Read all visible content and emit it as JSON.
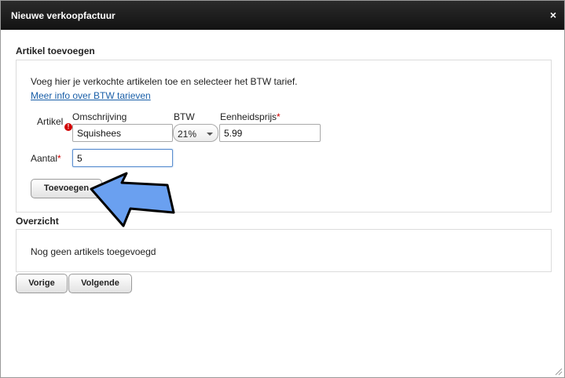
{
  "dialog": {
    "title": "Nieuwe verkoopfactuur",
    "close_label": "×"
  },
  "add_section": {
    "title": "Artikel toevoegen",
    "intro": "Voeg hier je verkochte artikelen toe en selecteer het BTW tarief.",
    "link": "Meer info over BTW tarieven",
    "article_label": "Artikel",
    "description_label": "Omschrijving",
    "description_value": "Squishees",
    "vat_label": "BTW",
    "vat_value": "21%",
    "price_label": "Eenheidsprijs",
    "price_value": "5.99",
    "quantity_label": "Aantal",
    "quantity_value": "5",
    "required_mark": "*",
    "error_mark": "!",
    "add_button": "Toevoegen"
  },
  "overview_section": {
    "title": "Overzicht",
    "empty_text": "Nog geen artikels toegevoegd"
  },
  "footer": {
    "prev_button": "Vorige",
    "next_button": "Volgende"
  },
  "colors": {
    "titlebar": "#1e1e1e",
    "link": "#1a5fa8",
    "required": "#d10000",
    "pointer_arrow": "#6aa0f0"
  }
}
